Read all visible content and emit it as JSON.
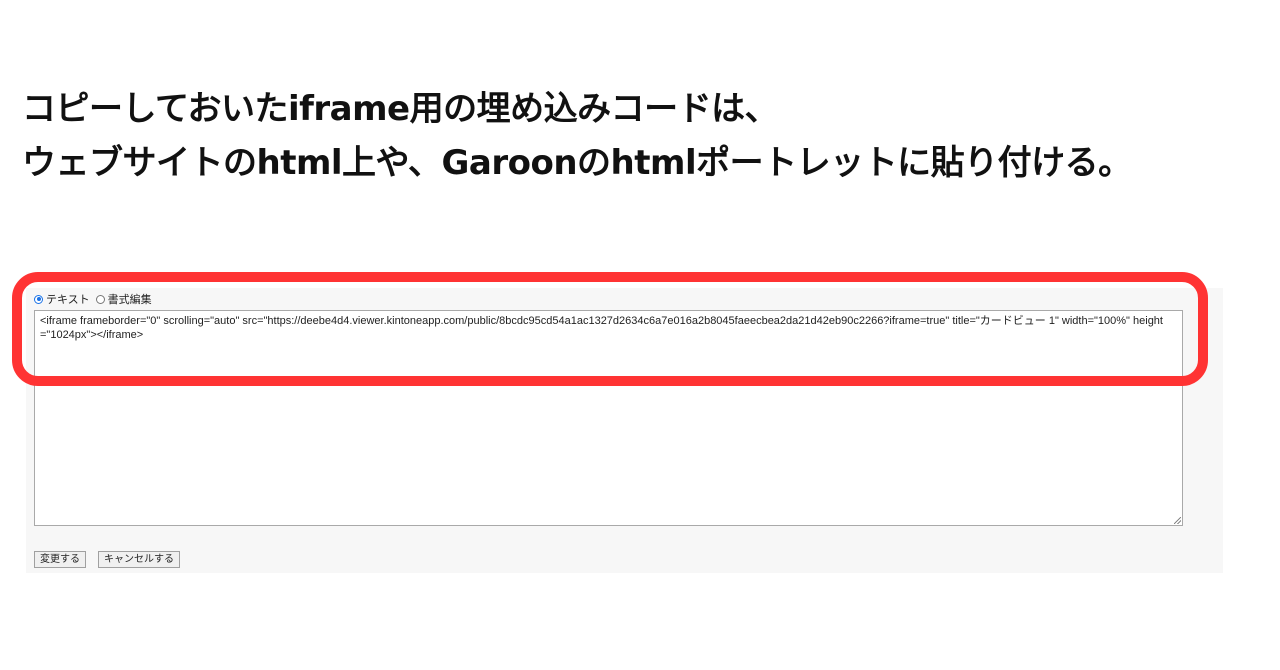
{
  "caption": {
    "line1": "コピーしておいたiframe用の埋め込みコードは、",
    "line2": "ウェブサイトのhtml上や、Garoonのhtmlポートレットに貼り付ける。"
  },
  "editor": {
    "modes": [
      {
        "label": "テキスト",
        "checked": true
      },
      {
        "label": "書式編集",
        "checked": false
      }
    ],
    "content": "<iframe frameborder=\"0\" scrolling=\"auto\" src=\"https://deebe4d4.viewer.kintoneapp.com/public/8bcdc95cd54a1ac1327d2634c6a7e016a2b8045faeecbea2da21d42eb90c2266?iframe=true\" title=\"カードビュー 1\" width=\"100%\" height=\"1024px\"></iframe>"
  },
  "buttons": {
    "submit_label": "変更する",
    "cancel_label": "キャンセルする"
  },
  "colors": {
    "highlight": "#ff3333",
    "panel_bg": "#f7f7f7",
    "radio_accent": "#1a73e8"
  }
}
